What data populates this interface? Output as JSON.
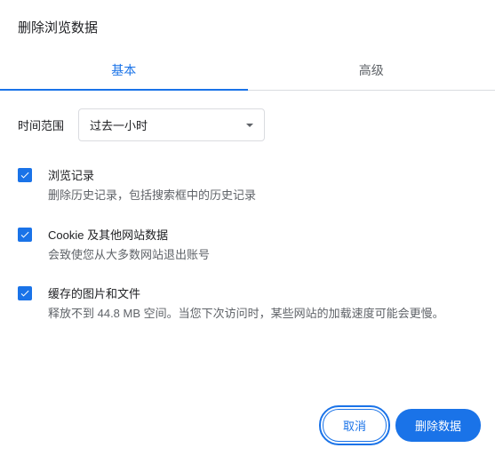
{
  "dialog": {
    "title": "删除浏览数据"
  },
  "tabs": {
    "basic": "基本",
    "advanced": "高级"
  },
  "timeRange": {
    "label": "时间范围",
    "selected": "过去一小时"
  },
  "items": [
    {
      "title": "浏览记录",
      "description": "删除历史记录，包括搜索框中的历史记录"
    },
    {
      "title": "Cookie 及其他网站数据",
      "description": "会致使您从大多数网站退出账号"
    },
    {
      "title": "缓存的图片和文件",
      "description": "释放不到 44.8 MB 空间。当您下次访问时，某些网站的加载速度可能会更慢。"
    }
  ],
  "buttons": {
    "cancel": "取消",
    "confirm": "删除数据"
  }
}
